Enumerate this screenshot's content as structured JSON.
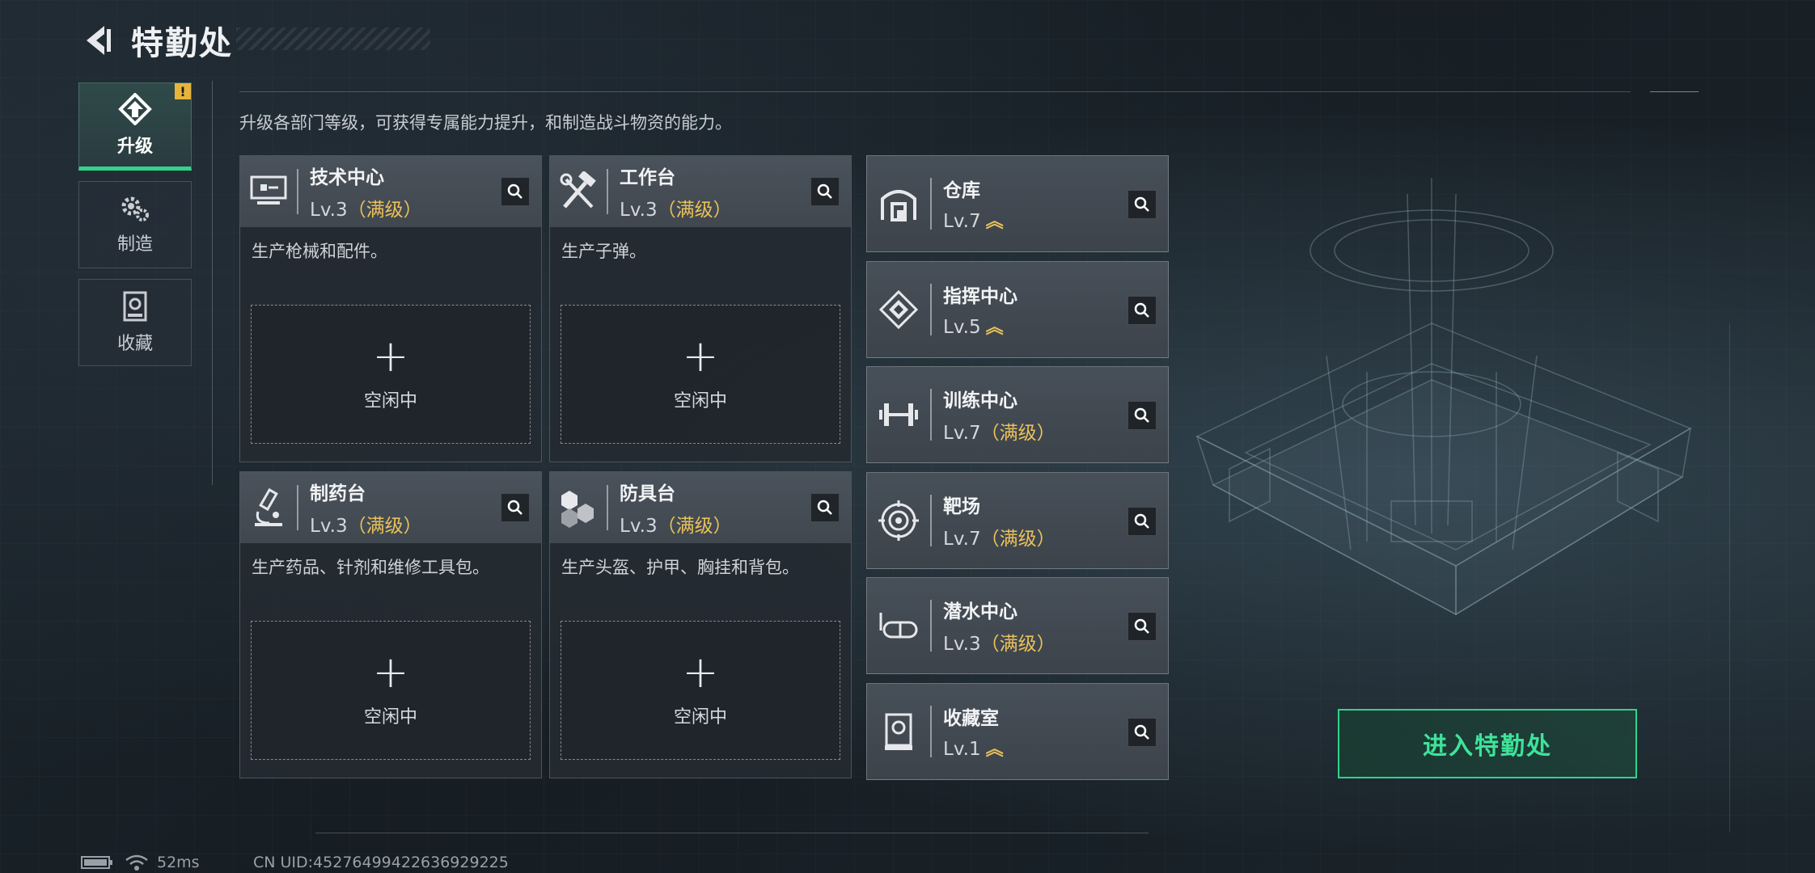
{
  "header": {
    "title": "特勤处"
  },
  "sidebar": {
    "tabs": [
      {
        "label": "升级",
        "active": true,
        "alert": "!"
      },
      {
        "label": "制造",
        "active": false
      },
      {
        "label": "收藏",
        "active": false
      }
    ]
  },
  "description": "升级各部门等级，可获得专属能力提升，和制造战斗物资的能力。",
  "workshops": [
    {
      "name": "技术中心",
      "level": "Lv.3",
      "max_tag": "（满级）",
      "desc": "生产枪械和配件。",
      "slot_label": "空闲中",
      "icon": "monitor-icon"
    },
    {
      "name": "工作台",
      "level": "Lv.3",
      "max_tag": "（满级）",
      "desc": "生产子弹。",
      "slot_label": "空闲中",
      "icon": "tools-icon"
    },
    {
      "name": "制药台",
      "level": "Lv.3",
      "max_tag": "（满级）",
      "desc": "生产药品、针剂和维修工具包。",
      "slot_label": "空闲中",
      "icon": "microscope-icon"
    },
    {
      "name": "防具台",
      "level": "Lv.3",
      "max_tag": "（满级）",
      "desc": "生产头盔、护甲、胸挂和背包。",
      "slot_label": "空闲中",
      "icon": "armor-icon"
    }
  ],
  "facilities": [
    {
      "name": "仓库",
      "level": "Lv.7",
      "max_tag": "",
      "upgradable": true,
      "icon": "warehouse-icon"
    },
    {
      "name": "指挥中心",
      "level": "Lv.5",
      "max_tag": "",
      "upgradable": true,
      "icon": "command-icon"
    },
    {
      "name": "训练中心",
      "level": "Lv.7",
      "max_tag": "（满级）",
      "upgradable": false,
      "icon": "dumbbell-icon"
    },
    {
      "name": "靶场",
      "level": "Lv.7",
      "max_tag": "（满级）",
      "upgradable": false,
      "icon": "target-icon"
    },
    {
      "name": "潜水中心",
      "level": "Lv.3",
      "max_tag": "（满级）",
      "upgradable": false,
      "icon": "goggles-icon"
    },
    {
      "name": "收藏室",
      "level": "Lv.1",
      "max_tag": "",
      "upgradable": true,
      "icon": "collection-icon"
    }
  ],
  "enter_button": "进入特勤处",
  "status": {
    "ping": "52ms",
    "uid": "CN UID:452764994226369292​25"
  },
  "colors": {
    "accent": "#31d58c",
    "gold": "#e9c15a",
    "alert": "#e6b43c"
  }
}
